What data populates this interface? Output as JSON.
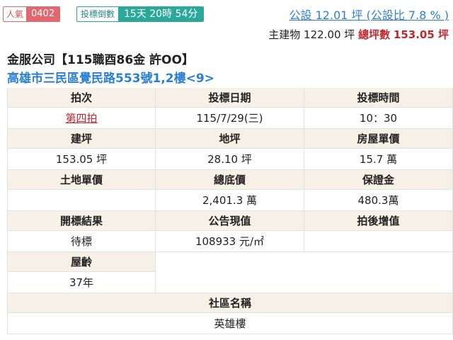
{
  "top": {
    "popularity_label": "人氣",
    "popularity_value": "0402",
    "countdown_label": "投標倒數",
    "countdown_value": "15天 20時 54分",
    "public_share": "公設 12.01 坪 (公設比 7.8 % )",
    "main_building_label": "主建物",
    "main_building_value": "122.00 坪",
    "total_label": "總坪數",
    "total_value": "153.05 坪"
  },
  "property": {
    "title": "金服公司【115職酉86金 許OO】",
    "address": "高雄市三民區覺民路553號1,2樓<9>"
  },
  "table": {
    "row1": {
      "h1": "拍次",
      "h2": "投標日期",
      "h3": "投標時間",
      "v1": "第四拍",
      "v2": "115/7/29(三)",
      "v3": "10：30"
    },
    "row2": {
      "h1": "建坪",
      "h2": "地坪",
      "h3": "房屋單價",
      "v1": "153.05 坪",
      "v2": "28.10 坪",
      "v3": "15.7 萬"
    },
    "row3": {
      "h1": "土地單價",
      "h2": "總底價",
      "h3": "保證金",
      "v1": "",
      "v2": "2,401.3 萬",
      "v3": "480.3萬"
    },
    "row4": {
      "h1": "開標結果",
      "h2": "公告現值",
      "h3": "拍後增值",
      "v1": "待標",
      "v2": "108933 元/㎡",
      "v3": ""
    },
    "row5": {
      "h1": "屋齡",
      "v1": "37年"
    },
    "row6": {
      "h1": "社區名稱",
      "v1": "英雄樓"
    }
  }
}
